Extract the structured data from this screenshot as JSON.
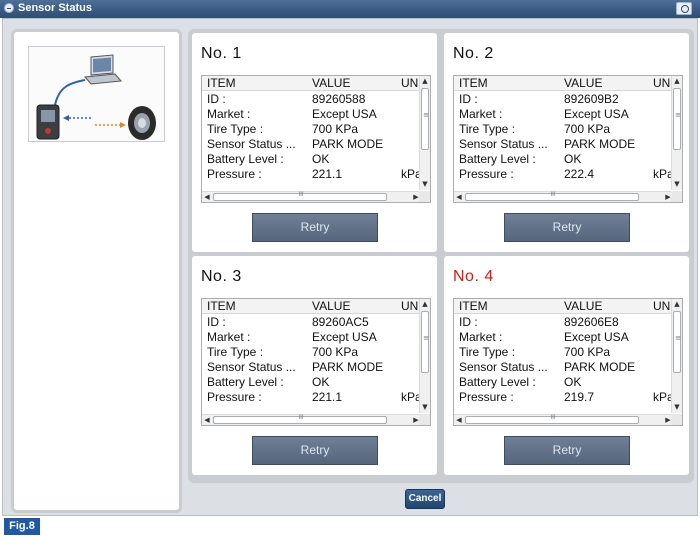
{
  "window": {
    "title": "Sensor Status"
  },
  "table_headers": {
    "item": "ITEM",
    "value": "VALUE",
    "unit": "UNIT"
  },
  "sensors": [
    {
      "title": "No. 1",
      "rows": [
        {
          "item": "ID :",
          "value": "89260588",
          "unit": ""
        },
        {
          "item": "Market :",
          "value": "Except USA",
          "unit": ""
        },
        {
          "item": "Tire Type :",
          "value": "700 KPa",
          "unit": ""
        },
        {
          "item": "Sensor Status ...",
          "value": "PARK MODE",
          "unit": ""
        },
        {
          "item": "Battery Level :",
          "value": "OK",
          "unit": ""
        },
        {
          "item": "Pressure :",
          "value": "221.1",
          "unit": "kPa"
        }
      ],
      "retry_label": "Retry"
    },
    {
      "title": "No. 2",
      "rows": [
        {
          "item": "ID :",
          "value": "892609B2",
          "unit": ""
        },
        {
          "item": "Market :",
          "value": "Except USA",
          "unit": ""
        },
        {
          "item": "Tire Type :",
          "value": "700 KPa",
          "unit": ""
        },
        {
          "item": "Sensor Status ...",
          "value": "PARK MODE",
          "unit": ""
        },
        {
          "item": "Battery Level :",
          "value": "OK",
          "unit": ""
        },
        {
          "item": "Pressure :",
          "value": "222.4",
          "unit": "kPa"
        }
      ],
      "retry_label": "Retry"
    },
    {
      "title": "No. 3",
      "rows": [
        {
          "item": "ID :",
          "value": "89260AC5",
          "unit": ""
        },
        {
          "item": "Market :",
          "value": "Except USA",
          "unit": ""
        },
        {
          "item": "Tire Type :",
          "value": "700 KPa",
          "unit": ""
        },
        {
          "item": "Sensor Status ...",
          "value": "PARK MODE",
          "unit": ""
        },
        {
          "item": "Battery Level :",
          "value": "OK",
          "unit": ""
        },
        {
          "item": "Pressure :",
          "value": "221.1",
          "unit": "kPa"
        }
      ],
      "retry_label": "Retry"
    },
    {
      "title": "No. 4",
      "alert": true,
      "rows": [
        {
          "item": "ID :",
          "value": "892606E8",
          "unit": ""
        },
        {
          "item": "Market :",
          "value": "Except USA",
          "unit": ""
        },
        {
          "item": "Tire Type :",
          "value": "700 KPa",
          "unit": ""
        },
        {
          "item": "Sensor Status ...",
          "value": "PARK MODE",
          "unit": ""
        },
        {
          "item": "Battery Level :",
          "value": "OK",
          "unit": ""
        },
        {
          "item": "Pressure :",
          "value": "219.7",
          "unit": "kPa"
        }
      ],
      "retry_label": "Retry"
    }
  ],
  "cancel_label": "Cancel",
  "figure_label": "Fig.8",
  "colors": {
    "titlebar": "#2d4c74",
    "alert_title": "#e0150f",
    "retry_button": "#6f7f95",
    "cancel_button": "#1f4670",
    "figure_label": "#1f58a6"
  },
  "icons": {
    "title_icon": "minus-circle-icon",
    "title_button": "camera-icon",
    "illustration": "tpms-tool-laptop-tire-illustration"
  }
}
